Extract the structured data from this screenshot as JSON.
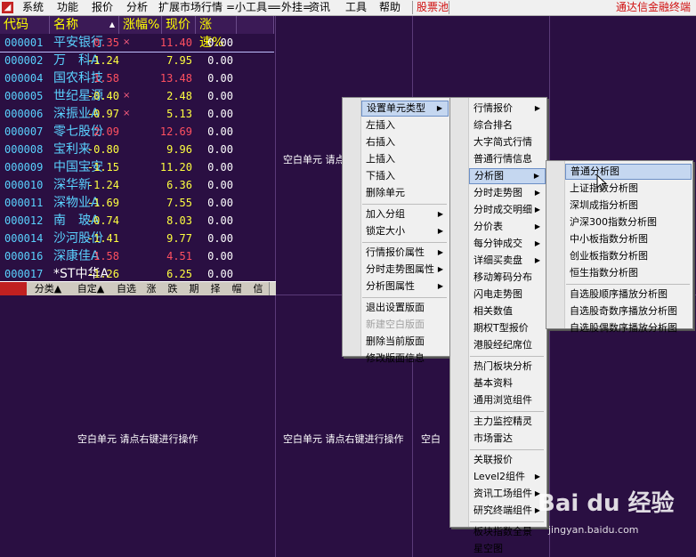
{
  "menubar": {
    "items": [
      "系统",
      "功能",
      "报价",
      "分析",
      "扩展市场行情",
      "=小工具=",
      "=外挂=",
      "资讯",
      "工具",
      "帮助"
    ],
    "pool": "股票池",
    "right": "通达信金融终端"
  },
  "table": {
    "headers": [
      "代码",
      "名称",
      "涨幅%",
      "现价",
      "涨速%"
    ],
    "name_sort_icon": "▲",
    "rows": [
      {
        "code": "000001",
        "name": "平安银行",
        "mark": "×",
        "chg": "0.35",
        "price": "11.40",
        "speed": "0.00",
        "color": "#ff5060"
      },
      {
        "code": "000002",
        "name": "万　科A",
        "mark": "",
        "chg": "-1.24",
        "price": "7.95",
        "speed": "0.00",
        "color": "#ffff40"
      },
      {
        "code": "000004",
        "name": "国农科技",
        "mark": "",
        "chg": "1.58",
        "price": "13.48",
        "speed": "0.00",
        "color": "#ff5060"
      },
      {
        "code": "000005",
        "name": "世纪星源",
        "mark": "×",
        "chg": "-0.40",
        "price": "2.48",
        "speed": "0.00",
        "color": "#ffff40"
      },
      {
        "code": "000006",
        "name": "深振业A",
        "mark": "×",
        "chg": "-0.97",
        "price": "5.13",
        "speed": "0.00",
        "color": "#ffff40"
      },
      {
        "code": "000007",
        "name": "零七股份",
        "mark": "",
        "chg": "2.09",
        "price": "12.69",
        "speed": "0.00",
        "color": "#ff5060"
      },
      {
        "code": "000008",
        "name": "宝利来",
        "mark": "",
        "chg": "-0.80",
        "price": "9.96",
        "speed": "0.00",
        "color": "#ffff40"
      },
      {
        "code": "000009",
        "name": "中国宝安",
        "mark": "",
        "chg": "-1.15",
        "price": "11.20",
        "speed": "0.00",
        "color": "#ffff40"
      },
      {
        "code": "000010",
        "name": "深华新",
        "mark": "",
        "chg": "-1.24",
        "price": "6.36",
        "speed": "0.00",
        "color": "#ffff40"
      },
      {
        "code": "000011",
        "name": "深物业A",
        "mark": "",
        "chg": "-1.69",
        "price": "7.55",
        "speed": "0.00",
        "color": "#ffff40"
      },
      {
        "code": "000012",
        "name": "南　玻A",
        "mark": "",
        "chg": "-0.74",
        "price": "8.03",
        "speed": "0.00",
        "color": "#ffff40"
      },
      {
        "code": "000014",
        "name": "沙河股份",
        "mark": "",
        "chg": "-1.41",
        "price": "9.77",
        "speed": "0.00",
        "color": "#ffff40"
      },
      {
        "code": "000016",
        "name": "深康佳A",
        "mark": "",
        "chg": "1.58",
        "price": "4.51",
        "speed": "0.00",
        "color": "#ff5060"
      },
      {
        "code": "000017",
        "name": "*ST中华A",
        "mark": "",
        "chg": "-1.26",
        "price": "6.25",
        "speed": "0.00",
        "color": "#ffff40"
      }
    ]
  },
  "tabs": [
    "分类▲",
    "自定▲",
    "自选",
    "涨",
    "跌",
    "期",
    "择",
    "帽",
    "信"
  ],
  "empty_cell_text": "空白单元 请点右键进行操作",
  "empty_cell_partial_1": "空白单元 请点",
  "empty_cell_partial_2": "空白",
  "menu1": {
    "items": [
      {
        "label": "设置单元类型",
        "arrow": "▶",
        "hl": true
      },
      {
        "label": "左插入"
      },
      {
        "label": "右插入"
      },
      {
        "label": "上插入"
      },
      {
        "label": "下插入"
      },
      {
        "label": "删除单元"
      },
      {
        "sep": true
      },
      {
        "label": "加入分组",
        "arrow": "▶"
      },
      {
        "label": "锁定大小",
        "arrow": "▶"
      },
      {
        "sep": true
      },
      {
        "label": "行情报价属性",
        "arrow": "▶"
      },
      {
        "label": "分时走势图属性",
        "arrow": "▶"
      },
      {
        "label": "分析图属性",
        "arrow": "▶"
      },
      {
        "sep": true
      },
      {
        "label": "退出设置版面"
      },
      {
        "label": "新建空白版面",
        "disabled": true
      },
      {
        "label": "删除当前版面"
      },
      {
        "label": "修改版面信息"
      }
    ]
  },
  "menu2": {
    "items": [
      {
        "label": "行情报价",
        "arrow": "▶"
      },
      {
        "label": "综合排名"
      },
      {
        "label": "大字简式行情"
      },
      {
        "label": "普通行情信息"
      },
      {
        "label": "分析图",
        "arrow": "▶",
        "hl": true
      },
      {
        "label": "分时走势图",
        "arrow": "▶"
      },
      {
        "label": "分时成交明细",
        "arrow": "▶"
      },
      {
        "label": "分价表",
        "arrow": "▶"
      },
      {
        "label": "每分钟成交",
        "arrow": "▶"
      },
      {
        "label": "详细买卖盘",
        "arrow": "▶"
      },
      {
        "label": "移动筹码分布"
      },
      {
        "label": "闪电走势图"
      },
      {
        "label": "相关数值"
      },
      {
        "label": "期权T型报价"
      },
      {
        "label": "港股经纪席位"
      },
      {
        "sep": true
      },
      {
        "label": "热门板块分析"
      },
      {
        "label": "基本资料"
      },
      {
        "label": "通用浏览组件"
      },
      {
        "sep": true
      },
      {
        "label": "主力监控精灵"
      },
      {
        "label": "市场雷达"
      },
      {
        "sep": true
      },
      {
        "label": "关联报价"
      },
      {
        "label": "Level2组件",
        "arrow": "▶"
      },
      {
        "label": "资讯工场组件",
        "arrow": "▶"
      },
      {
        "label": "研究终端组件",
        "arrow": "▶"
      },
      {
        "sep": true
      },
      {
        "label": "板块指数全景"
      },
      {
        "label": "星空图"
      }
    ]
  },
  "menu3": {
    "items": [
      {
        "label": "普通分析图",
        "hl": true
      },
      {
        "label": "上证指数分析图"
      },
      {
        "label": "深圳成指分析图"
      },
      {
        "label": "沪深300指数分析图"
      },
      {
        "label": "中小板指数分析图"
      },
      {
        "label": "创业板指数分析图"
      },
      {
        "label": "恒生指数分析图"
      },
      {
        "sep": true
      },
      {
        "label": "自选股顺序播放分析图"
      },
      {
        "label": "自选股奇数序播放分析图"
      },
      {
        "label": "自选股偶数序播放分析图"
      }
    ]
  },
  "watermark": {
    "brand": "Bai du 经验",
    "url": "jingyan.baidu.com"
  },
  "colors": {
    "bg": "#2a0f42",
    "code": "#5ad2ff",
    "up": "#ff5060",
    "down": "#ffff40",
    "header": "#ffff00"
  }
}
